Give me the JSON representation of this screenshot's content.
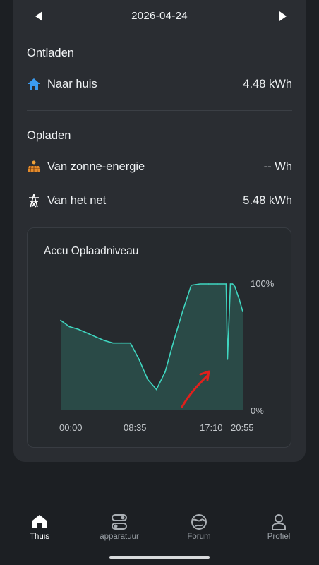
{
  "header": {
    "date": "2026-04-24"
  },
  "discharge": {
    "title": "Ontladen",
    "rows": [
      {
        "label": "Naar huis",
        "value": "4.48 kWh",
        "icon": "house-icon"
      }
    ]
  },
  "charge": {
    "title": "Opladen",
    "rows": [
      {
        "label": "Van zonne-energie",
        "value": "-- Wh",
        "icon": "solar-panel-icon"
      },
      {
        "label": "Van het net",
        "value": "5.48 kWh",
        "icon": "power-pylon-icon"
      }
    ]
  },
  "chart": {
    "title": "Accu Oplaadniveau",
    "y_top_label": "100%",
    "y_bottom_label": "0%",
    "x_labels": [
      "00:00",
      "08:35",
      "17:10",
      "20:55"
    ],
    "line_color": "#3fd6c0",
    "fill_color": "#2a4a47",
    "annotation_color": "#e0201c"
  },
  "chart_data": {
    "type": "area",
    "title": "Accu Oplaadniveau",
    "xlabel": "",
    "ylabel": "",
    "ylim": [
      0,
      100
    ],
    "x_ticks": [
      "00:00",
      "08:35",
      "17:10",
      "20:55"
    ],
    "x": [
      "00:00",
      "01:00",
      "02:00",
      "03:00",
      "04:00",
      "05:00",
      "06:00",
      "07:00",
      "08:00",
      "09:00",
      "10:00",
      "11:00",
      "12:00",
      "13:00",
      "14:00",
      "15:00",
      "16:00",
      "17:00",
      "18:00",
      "19:00",
      "19:10",
      "19:30",
      "19:45",
      "20:00",
      "20:30",
      "20:55"
    ],
    "series": [
      {
        "values": [
          71,
          66,
          64,
          61,
          58,
          55,
          53,
          53,
          53,
          40,
          24,
          16,
          30,
          55,
          78,
          99,
          100,
          100,
          100,
          100,
          40,
          100,
          100,
          98,
          88,
          78
        ]
      }
    ],
    "grid": false,
    "annotations": [
      "red arrow pointing at the sudden dip near 19:00"
    ]
  },
  "tabbar": {
    "tabs": [
      {
        "label": "Thuis",
        "icon": "home-icon",
        "active": true
      },
      {
        "label": "apparatuur",
        "icon": "devices-icon",
        "active": false
      },
      {
        "label": "Forum",
        "icon": "globe-icon",
        "active": false
      },
      {
        "label": "Profiel",
        "icon": "profile-icon",
        "active": false
      }
    ]
  }
}
